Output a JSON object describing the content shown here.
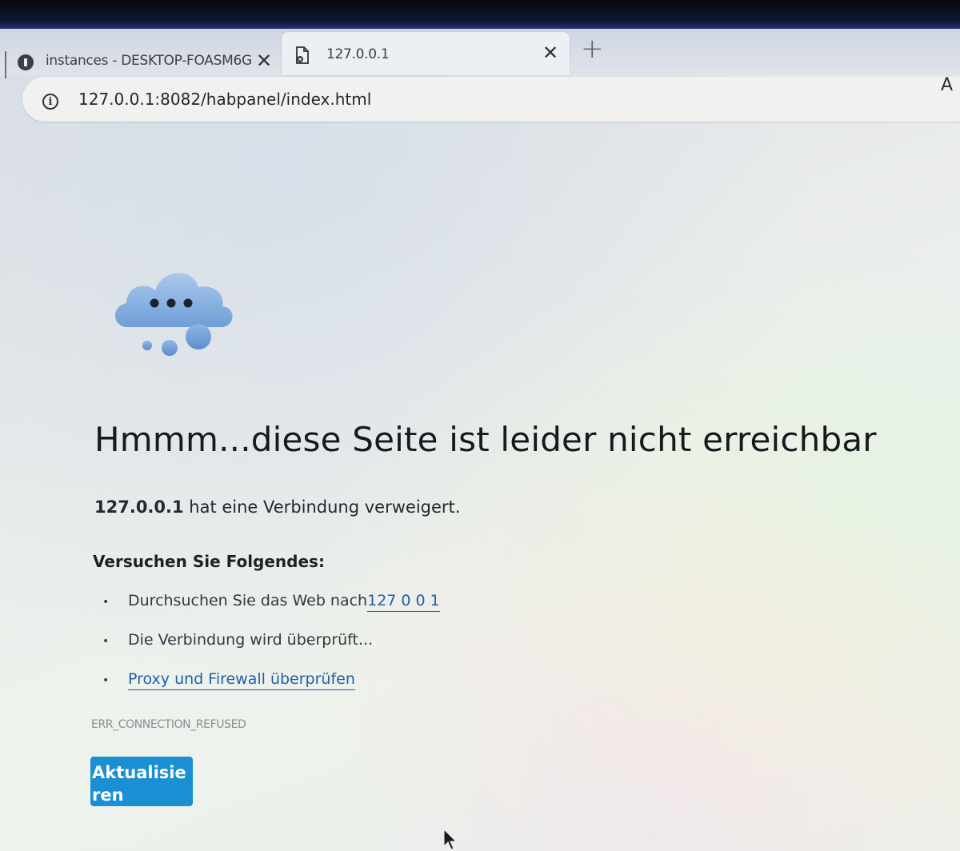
{
  "browser": {
    "tabs": [
      {
        "label": "instances - DESKTOP-FOASM6G",
        "icon": "round-info-icon",
        "active": false
      },
      {
        "label": "127.0.0.1",
        "icon": "page-error-icon",
        "active": true
      }
    ],
    "close_glyph": "✕",
    "new_tab_glyph": "+",
    "address": {
      "url": "127.0.0.1:8082/habpanel/index.html",
      "icon": "info-icon"
    },
    "read_aloud_label": "A"
  },
  "error_page": {
    "icon": "cloud-thought-icon",
    "headline": "Hmmm...diese Seite ist leider nicht erreichbar",
    "host": "127.0.0.1",
    "message_suffix": " hat eine Verbindung verweigert.",
    "try_heading": "Versuchen Sie Folgendes:",
    "suggestions": [
      {
        "text": "Durchsuchen Sie das Web nach ",
        "link": "127 0 0 1"
      },
      {
        "text": "Die Verbindung wird überprüft...",
        "link": ""
      },
      {
        "text": "",
        "link": "Proxy und Firewall überprüfen"
      }
    ],
    "error_code": "ERR_CONNECTION_REFUSED",
    "refresh_button": "Aktualisieren"
  },
  "colors": {
    "accent": "#1a8fd3",
    "link": "#1f5fa8",
    "headline": "#17191e"
  }
}
